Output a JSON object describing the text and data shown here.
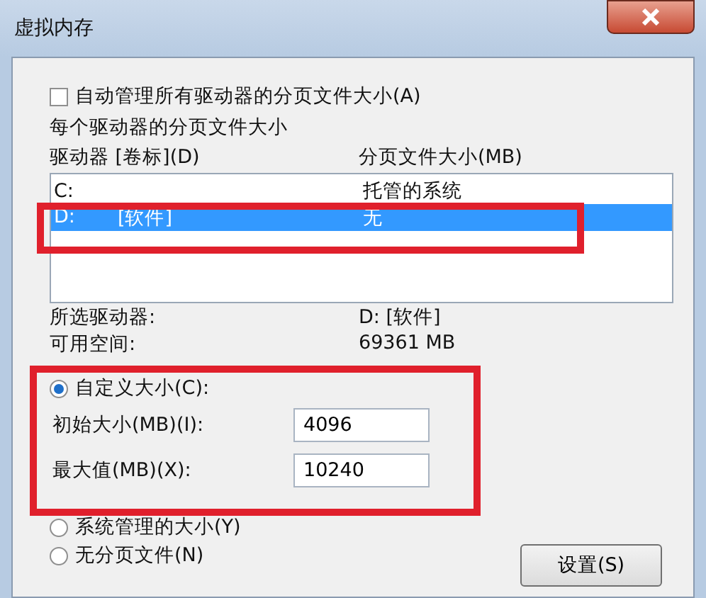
{
  "window": {
    "title": "虚拟内存"
  },
  "auto_manage": {
    "label": "自动管理所有驱动器的分页文件大小(A)",
    "checked": false
  },
  "group": {
    "title": "每个驱动器的分页文件大小",
    "columns": [
      "驱动器 [卷标](D)",
      "分页文件大小(MB)"
    ],
    "rows": [
      {
        "drive": "C:",
        "label": "",
        "size": "托管的系统",
        "selected": false
      },
      {
        "drive": "D:",
        "label": "[软件]",
        "size": "无",
        "selected": true
      }
    ],
    "selected_drive_label": "所选驱动器:",
    "selected_drive_value": "D:  [软件]",
    "free_space_label": "可用空间:",
    "free_space_value": "69361 MB",
    "options": [
      {
        "kind": "radio",
        "label": "自定义大小(C):",
        "selected": true
      },
      {
        "kind": "field",
        "label": "初始大小(MB)(I):",
        "value": "4096"
      },
      {
        "kind": "field",
        "label": "最大值(MB)(X):",
        "value": "10240"
      },
      {
        "kind": "radio",
        "label": "系统管理的大小(Y)",
        "selected": false
      },
      {
        "kind": "radio",
        "label": "无分页文件(N)",
        "selected": false
      }
    ],
    "set_button": "设置(S)"
  }
}
